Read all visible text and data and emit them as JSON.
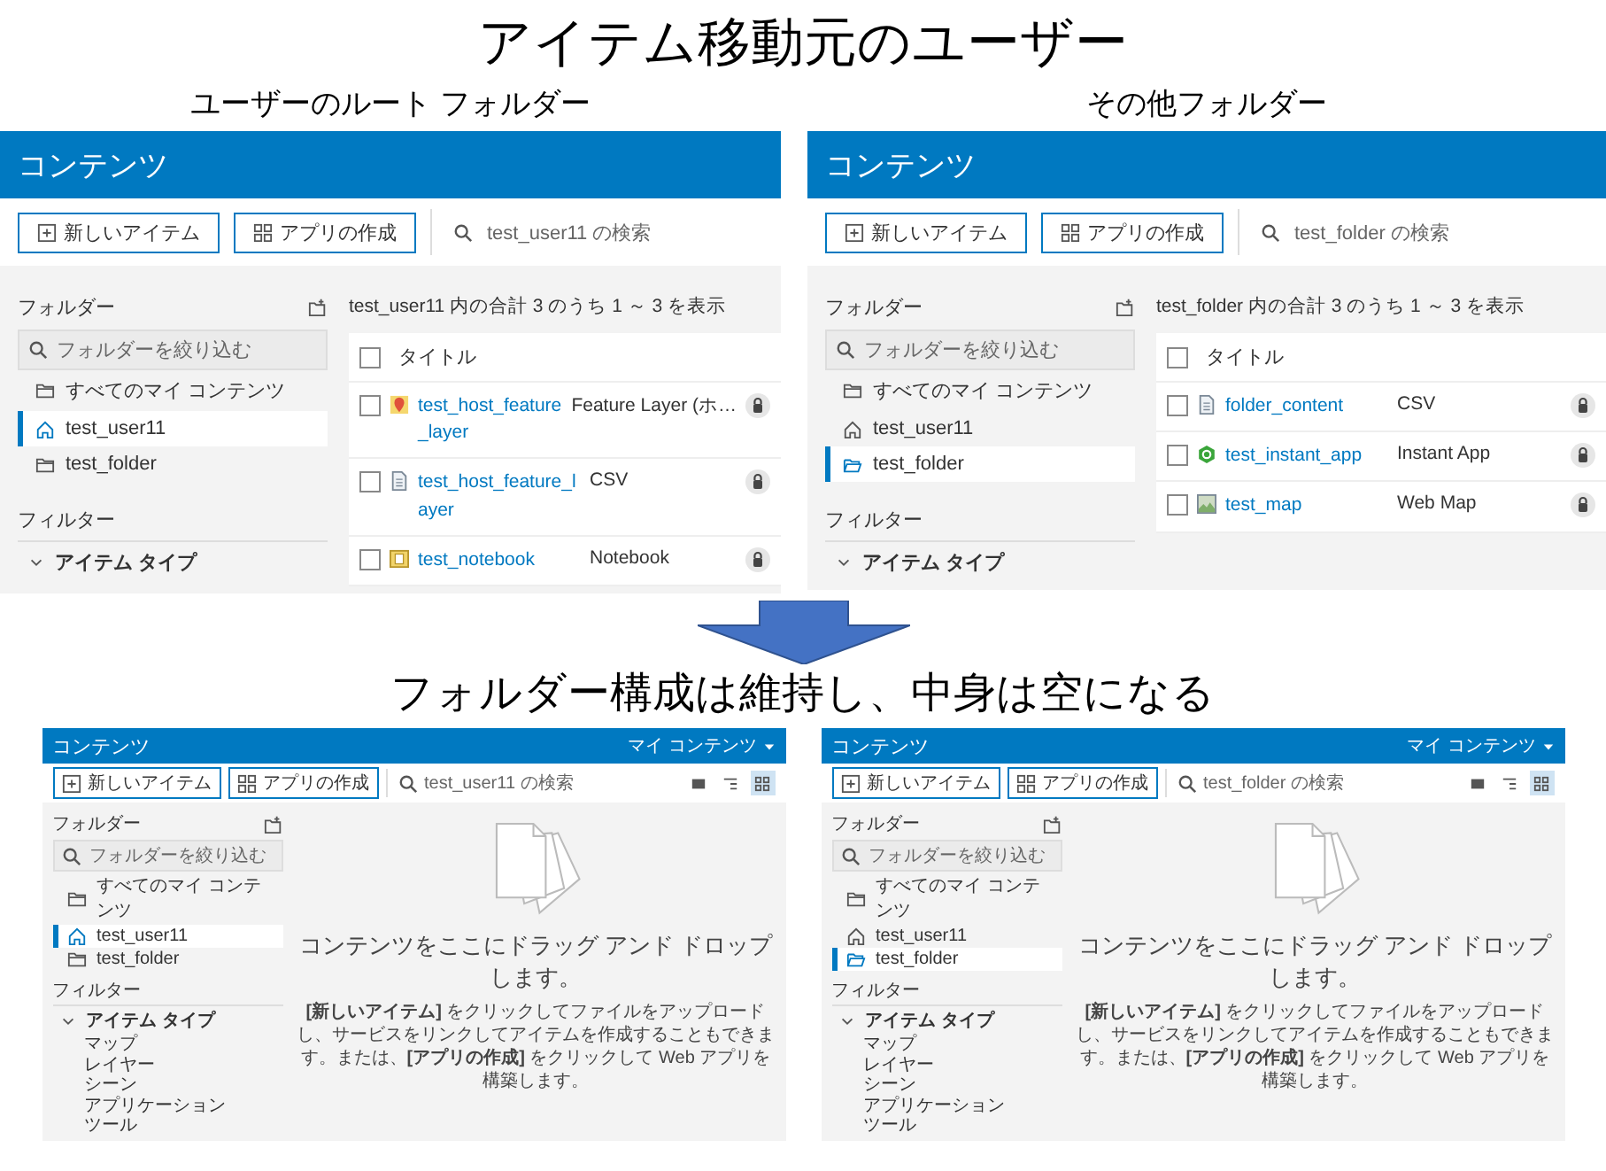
{
  "title": "アイテム移動元のユーザー",
  "before": [
    {
      "caption": "ユーザーのルート フォルダー",
      "header": "コンテンツ",
      "buttons": [
        {
          "label": "新しいアイテム",
          "kind": "new"
        },
        {
          "label": "アプリの作成",
          "kind": "app"
        }
      ],
      "search_placeholder": "test_user11 の検索",
      "folders_heading": "フォルダー",
      "folder_filter_placeholder": "フォルダーを絞り込む",
      "folders": [
        {
          "label": "すべてのマイ コンテンツ",
          "kind": "all",
          "selected": false
        },
        {
          "label": "test_user11",
          "kind": "home",
          "selected": true
        },
        {
          "label": "test_folder",
          "kind": "folder",
          "selected": false
        }
      ],
      "filters_heading": "フィルター",
      "item_type_heading": "アイテム タイプ",
      "item_type_expanded": true,
      "summary": "test_user11 内の合計 3 のうち 1 ～ 3 を表示",
      "title_column": "タイトル",
      "header_checked": false,
      "rows": [
        {
          "title": "test_host_feature_layer",
          "type": "Feature Layer (ホ…",
          "kind": "feature-layer",
          "checked": false
        },
        {
          "title": "test_host_feature_layer",
          "type": "CSV",
          "kind": "csv",
          "checked": false
        },
        {
          "title": "test_notebook",
          "type": "Notebook",
          "kind": "notebook",
          "checked": false
        }
      ]
    },
    {
      "caption": "その他フォルダー",
      "header": "コンテンツ",
      "buttons": [
        {
          "label": "新しいアイテム",
          "kind": "new"
        },
        {
          "label": "アプリの作成",
          "kind": "app"
        }
      ],
      "search_placeholder": "test_folder の検索",
      "folders_heading": "フォルダー",
      "folder_filter_placeholder": "フォルダーを絞り込む",
      "folders": [
        {
          "label": "すべてのマイ コンテンツ",
          "kind": "all",
          "selected": false
        },
        {
          "label": "test_user11",
          "kind": "home",
          "selected": false
        },
        {
          "label": "test_folder",
          "kind": "folder",
          "selected": true
        }
      ],
      "filters_heading": "フィルター",
      "item_type_heading": "アイテム タイプ",
      "item_type_expanded": true,
      "summary": "test_folder 内の合計 3 のうち 1 ～ 3 を表示",
      "title_column": "タイトル",
      "header_checked": false,
      "rows": [
        {
          "title": "folder_content",
          "type": "CSV",
          "kind": "csv",
          "checked": false
        },
        {
          "title": "test_instant_app",
          "type": "Instant App",
          "kind": "instant-app",
          "checked": false
        },
        {
          "title": "test_map",
          "type": "Web Map",
          "kind": "web-map",
          "checked": false
        }
      ]
    }
  ],
  "subtitle": "フォルダー構成は維持し、中身は空になる",
  "after": [
    {
      "header": "コンテンツ",
      "menu": "マイ コンテンツ",
      "buttons": [
        {
          "label": "新しいアイテム",
          "kind": "new"
        },
        {
          "label": "アプリの作成",
          "kind": "app"
        }
      ],
      "search_placeholder": "test_user11 の検索",
      "views": [
        {
          "kind": "table",
          "selected": false
        },
        {
          "kind": "list",
          "selected": false
        },
        {
          "kind": "grid",
          "selected": true
        }
      ],
      "folders_heading": "フォルダー",
      "folder_filter_placeholder": "フォルダーを絞り込む",
      "folders": [
        {
          "label": "すべてのマイ コンテンツ",
          "kind": "all",
          "selected": false
        },
        {
          "label": "test_user11",
          "kind": "home",
          "selected": true
        },
        {
          "label": "test_folder",
          "kind": "folder",
          "selected": false
        }
      ],
      "filters_heading": "フィルター",
      "item_type_heading": "アイテム タイプ",
      "item_type_expanded": true,
      "item_types": [
        "マップ",
        "レイヤー",
        "シーン",
        "アプリケーション",
        "ツール"
      ],
      "empty_heading": "コンテンツをここにドラッグ アンド ドロップします。",
      "empty_text": "**[新しいアイテム]** をクリックしてファイルをアップロードし、サービスをリンクしてアイテムを作成することもできます。または、**[アプリの作成]** をクリックして Web アプリを構築します。"
    },
    {
      "header": "コンテンツ",
      "menu": "マイ コンテンツ",
      "buttons": [
        {
          "label": "新しいアイテム",
          "kind": "new"
        },
        {
          "label": "アプリの作成",
          "kind": "app"
        }
      ],
      "search_placeholder": "test_folder の検索",
      "views": [
        {
          "kind": "table",
          "selected": false
        },
        {
          "kind": "list",
          "selected": false
        },
        {
          "kind": "grid",
          "selected": true
        }
      ],
      "folders_heading": "フォルダー",
      "folder_filter_placeholder": "フォルダーを絞り込む",
      "folders": [
        {
          "label": "すべてのマイ コンテンツ",
          "kind": "all",
          "selected": false
        },
        {
          "label": "test_user11",
          "kind": "home",
          "selected": false
        },
        {
          "label": "test_folder",
          "kind": "folder",
          "selected": true
        }
      ],
      "filters_heading": "フィルター",
      "item_type_heading": "アイテム タイプ",
      "item_type_expanded": true,
      "item_types": [
        "マップ",
        "レイヤー",
        "シーン",
        "アプリケーション",
        "ツール"
      ],
      "empty_heading": "コンテンツをここにドラッグ アンド ドロップします。",
      "empty_text": "**[新しいアイテム]** をクリックしてファイルをアップロードし、サービスをリンクしてアイテムを作成することもできます。または、**[アプリの作成]** をクリックして Web アプリを構築します。"
    }
  ]
}
